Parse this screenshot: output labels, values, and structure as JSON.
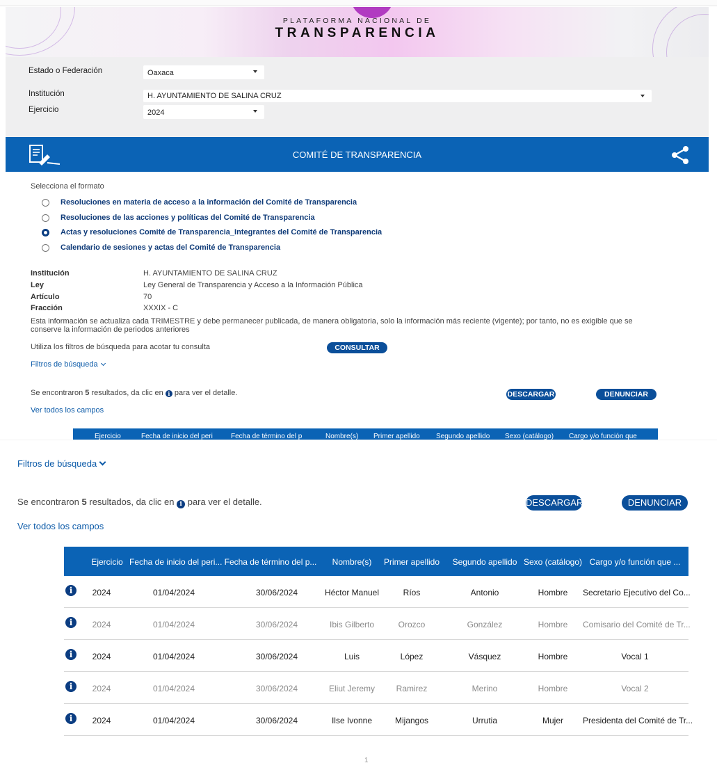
{
  "header": {
    "logo_line1": "PLATAFORMA NACIONAL DE",
    "logo_line2": "TRANSPARENCIA"
  },
  "filters": {
    "estado_label": "Estado o Federación",
    "estado_value": "Oaxaca",
    "institucion_label": "Institución",
    "institucion_value": "H. AYUNTAMIENTO DE SALINA CRUZ",
    "ejercicio_label": "Ejercicio",
    "ejercicio_value": "2024"
  },
  "section": {
    "title": "COMITÉ DE TRANSPARENCIA",
    "icons": {
      "left": "document-edit-icon",
      "right": "share-icon"
    }
  },
  "formats": {
    "title": "Selecciona el formato",
    "options": [
      {
        "label": "Resoluciones en materia de acceso a la información del Comité de Transparencia",
        "selected": false
      },
      {
        "label": "Resoluciones de las acciones y políticas del Comité de Transparencia",
        "selected": false
      },
      {
        "label": "Actas y resoluciones Comité de Transparencia_Integrantes del Comité de Transparencia",
        "selected": true
      },
      {
        "label": "Calendario de sesiones y actas del Comité de Transparencia",
        "selected": false
      }
    ]
  },
  "info": {
    "institucion_label": "Institución",
    "institucion": "H. AYUNTAMIENTO DE SALINA CRUZ",
    "ley_label": "Ley",
    "ley": "Ley General de Transparencia y Acceso a la Información Pública",
    "articulo_label": "Artículo",
    "articulo": "70",
    "fraccion_label": "Fracción",
    "fraccion": "XXXIX - C",
    "note": "Esta información se actualiza cada TRIMESTRE y debe permanecer publicada, de manera obligatoria, solo la información más reciente (vigente); por tanto, no es exigible que se conserve la información de periodos anteriores"
  },
  "search": {
    "hint": "Utiliza los filtros de búsqueda para acotar tu consulta",
    "consultar": "CONSULTAR",
    "filtros_label": "Filtros de búsqueda"
  },
  "results": {
    "prefix": "Se encontraron ",
    "count": "5",
    "middle": " resultados, da clic en ",
    "suffix": " para ver el detalle.",
    "descargar": "DESCARGAR",
    "denunciar": "DENUNCIAR",
    "ver_todos": "Ver todos los campos"
  },
  "table": {
    "columns": [
      "Ejercicio",
      "Fecha de inicio del peri...",
      "Fecha de término del p...",
      "Nombre(s)",
      "Primer apellido",
      "Segundo apellido",
      "Sexo (catálogo)",
      "Cargo y/o función que ..."
    ],
    "mini_columns": [
      "Ejercicio",
      "Fecha de inicio del peri",
      "Fecha de término del p",
      "Nombre(s)",
      "Primer apellido",
      "Segundo apellido",
      "Sexo (catálogo)",
      "Cargo y/o función que"
    ],
    "rows": [
      [
        "2024",
        "01/04/2024",
        "30/06/2024",
        "Héctor Manuel",
        "Ríos",
        "Antonio",
        "Hombre",
        "Secretario Ejecutivo del Co..."
      ],
      [
        "2024",
        "01/04/2024",
        "30/06/2024",
        "Ibis Gilberto",
        "Orozco",
        "González",
        "Hombre",
        "Comisario del Comité de Tr..."
      ],
      [
        "2024",
        "01/04/2024",
        "30/06/2024",
        "Luis",
        "López",
        "Vásquez",
        "Hombre",
        "Vocal 1"
      ],
      [
        "2024",
        "01/04/2024",
        "30/06/2024",
        "Eliut Jeremy",
        "Ramirez",
        "Merino",
        "Hombre",
        "Vocal 2"
      ],
      [
        "2024",
        "01/04/2024",
        "30/06/2024",
        "Ilse Ivonne",
        "Mijangos",
        "Urrutia",
        "Mujer",
        "Presidenta del Comité de Tr..."
      ]
    ]
  },
  "pagination": {
    "page": "1"
  },
  "colors": {
    "primary": "#0b63b5",
    "dark": "#0b3d82",
    "panel": "#efeff0"
  }
}
